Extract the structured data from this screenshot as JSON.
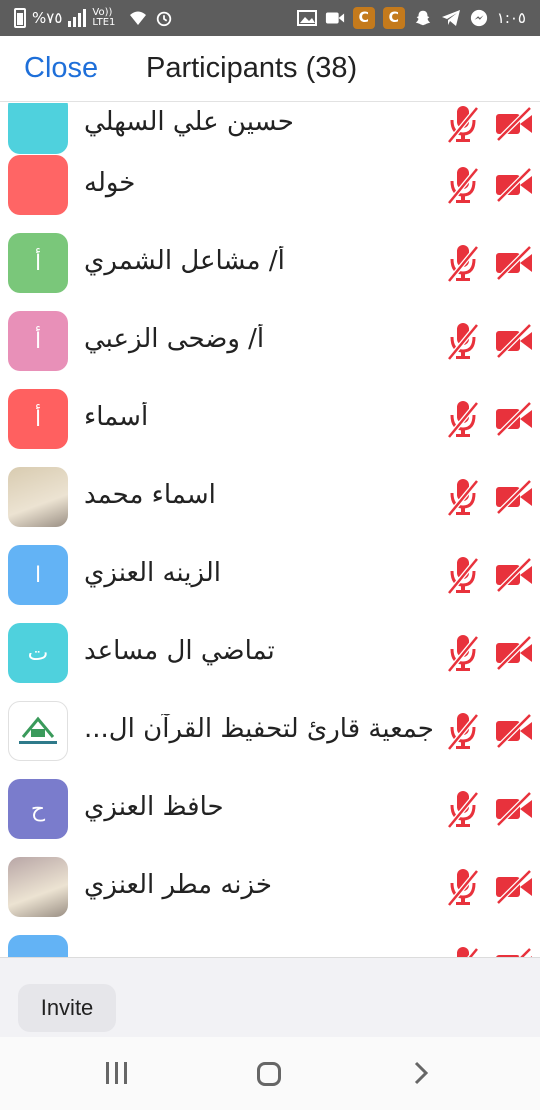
{
  "status_bar": {
    "battery_percent": "%٧٥",
    "network_label": "Vo)) LTE1",
    "time": "١:٠٥",
    "app_badge": "C",
    "icons": [
      "battery-icon",
      "signal-icon",
      "wifi-icon",
      "alarm-icon",
      "gallery-icon",
      "video-icon",
      "snapchat-icon",
      "telegram-icon",
      "messenger-icon"
    ]
  },
  "header": {
    "close_label": "Close",
    "title": "Participants (38)",
    "accent_color": "#1e6fd9"
  },
  "participants": [
    {
      "name": "حسين علي السهلي",
      "initial": "",
      "avatar_color": "#4fd1dd",
      "mic": "muted",
      "video": "off"
    },
    {
      "name": "خوله",
      "initial": "",
      "avatar_color": "#ff6565",
      "mic": "muted",
      "video": "off"
    },
    {
      "name": "أ/ مشاعل الشمري",
      "initial": "أ",
      "avatar_color": "#7ac77a",
      "mic": "muted",
      "video": "off"
    },
    {
      "name": "أ/ وضحى الزعبي",
      "initial": "أ",
      "avatar_color": "#e890b8",
      "mic": "muted",
      "video": "off"
    },
    {
      "name": "أسماء",
      "initial": "أ",
      "avatar_color": "#ff6060",
      "mic": "muted",
      "video": "off"
    },
    {
      "name": "اسماء محمد",
      "initial": "",
      "avatar_color": "#d8cbb0",
      "avatar_photo": true,
      "mic": "muted",
      "video": "off"
    },
    {
      "name": "الزينه العنزي",
      "initial": "ا",
      "avatar_color": "#63b3f5",
      "mic": "muted",
      "video": "off"
    },
    {
      "name": "تماضي ال مساعد",
      "initial": "ت",
      "avatar_color": "#4fd1dd",
      "mic": "muted",
      "video": "off"
    },
    {
      "name": "جمعية قارئ لتحفيظ القرآن ال...",
      "initial": "",
      "avatar_color": "#ffffff",
      "avatar_logo": true,
      "mic": "muted",
      "video": "off"
    },
    {
      "name": "حافظ العنزي",
      "initial": "ح",
      "avatar_color": "#7a7ccc",
      "mic": "muted",
      "video": "off"
    },
    {
      "name": "خزنه مطر العنزي",
      "initial": "",
      "avatar_color": "#b8a6a6",
      "avatar_photo": true,
      "mic": "muted",
      "video": "off"
    },
    {
      "name": "",
      "initial": "",
      "avatar_color": "#63b3f5",
      "mic": "muted",
      "video": "off"
    }
  ],
  "footer": {
    "invite_label": "Invite"
  },
  "muted_color": "#e8323c"
}
